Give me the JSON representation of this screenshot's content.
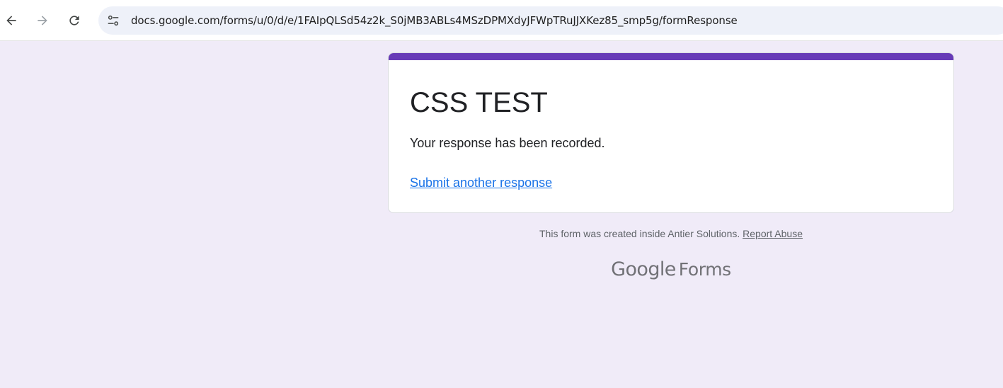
{
  "browser": {
    "url": "docs.google.com/forms/u/0/d/e/1FAIpQLSd54z2k_S0jMB3ABLs4MSzDPMXdyJFWpTRuJJXKez85_smp5g/formResponse",
    "icons": {
      "back": "arrow-back-icon",
      "forward": "arrow-forward-icon",
      "reload": "reload-icon",
      "site_info": "tune-icon"
    }
  },
  "form": {
    "title": "CSS TEST",
    "confirmation_message": "Your response has been recorded.",
    "submit_another_label": "Submit another response",
    "accent_color": "#673ab7",
    "link_color": "#1a73e8"
  },
  "footer": {
    "created_text": "This form was created inside Antier Solutions.",
    "report_abuse_label": "Report Abuse",
    "brand_google": "Google",
    "brand_forms": "Forms"
  },
  "colors": {
    "page_background": "#f0ebf8",
    "text_primary": "#202124",
    "text_secondary": "#5f6368"
  }
}
